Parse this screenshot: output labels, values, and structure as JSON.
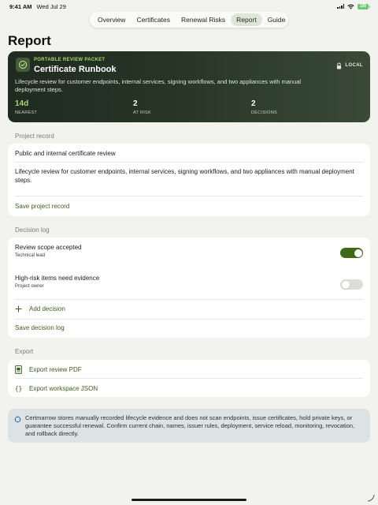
{
  "status_bar": {
    "time": "9:41 AM",
    "date": "Wed Jul 29",
    "battery": "100"
  },
  "nav": {
    "tabs": [
      {
        "label": "Overview",
        "active": false
      },
      {
        "label": "Certificates",
        "active": false
      },
      {
        "label": "Renewal Risks",
        "active": false
      },
      {
        "label": "Report",
        "active": true
      },
      {
        "label": "Guide",
        "active": false
      }
    ]
  },
  "page": {
    "title": "Report"
  },
  "hero": {
    "eyebrow": "PORTABLE REVIEW PACKET",
    "title": "Certificate Runbook",
    "badge_icon": "check-seal-icon",
    "mode": "LOCAL",
    "description": "Lifecycle review for customer endpoints, internal services, signing workflows, and two appliances with manual deployment steps.",
    "metrics": [
      {
        "value": "14d",
        "label": "NEAREST"
      },
      {
        "value": "2",
        "label": "AT RISK"
      },
      {
        "value": "2",
        "label": "DECISIONS"
      }
    ],
    "accent": "#a9d66a"
  },
  "project_record": {
    "heading": "Project record",
    "name": "Public and internal certificate review",
    "description": "Lifecycle review for customer endpoints, internal services, signing workflows, and two appliances with manual deployment steps.",
    "save_label": "Save project record"
  },
  "decision_log": {
    "heading": "Decision log",
    "items": [
      {
        "title": "Review scope accepted",
        "owner": "Technical lead",
        "enabled": true
      },
      {
        "title": "High-risk items need evidence",
        "owner": "Project owner",
        "enabled": false
      }
    ],
    "add_label": "Add decision",
    "save_label": "Save decision log"
  },
  "export": {
    "heading": "Export",
    "pdf_label": "Export review PDF",
    "json_label": "Export workspace JSON"
  },
  "notice": {
    "text": "Certmarrow stores manually recorded lifecycle evidence and does not scan endpoints, issue certificates, hold private keys, or guarantee successful renewal. Confirm current chain, names, issuer rules, deployment, service reload, monitoring, revocation, and rollback directly."
  },
  "colors": {
    "accent_green": "#3e5e20",
    "toggle_on": "#3e6a18",
    "hero_dark": "#1f2b1f"
  }
}
